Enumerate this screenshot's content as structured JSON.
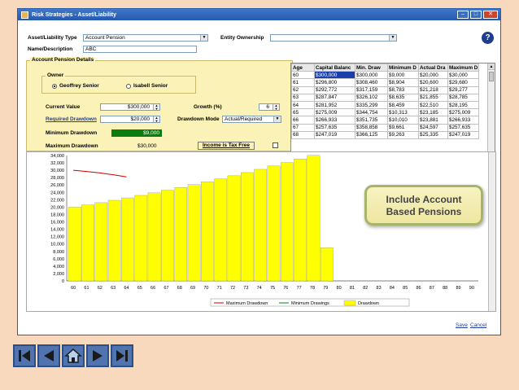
{
  "window": {
    "title": "Risk Strategies - Asset/Liability"
  },
  "form": {
    "asset_type_label": "Asset/Liability Type",
    "asset_type_value": "Account Pension",
    "entity_label": "Entity Ownership",
    "entity_value": "",
    "name_label": "Name/Description",
    "name_value": "ABC"
  },
  "details": {
    "group_title": "Account Pension Details",
    "owner_title": "Owner",
    "owner_options": [
      "Geoffrey Senior",
      "Isabell Senior"
    ],
    "current_value_label": "Current Value",
    "current_value": "$300,000",
    "growth_label": "Growth (%)",
    "growth_value": "6",
    "required_drawdown_label": "Required Drawdown",
    "required_drawdown_value": "$20,000",
    "drawdown_mode_label": "Drawdown Mode",
    "drawdown_mode_value": "Actual/Required",
    "minimum_drawdown_label": "Minimum Drawdown",
    "minimum_drawdown_value": "$9,000",
    "maximum_drawdown_label": "Maximum Drawdown",
    "maximum_drawdown_value": "$30,000",
    "income_button": "Income is Tax Free"
  },
  "grid": {
    "headers": [
      "Age",
      "Capital Balanc",
      "Min. Draw",
      "Minimum D",
      "Actual Dra",
      "Maximum D"
    ],
    "rows": [
      [
        "60",
        "$300,000",
        "$300,000",
        "$9,000",
        "$20,000",
        "$30,000"
      ],
      [
        "61",
        "$296,800",
        "$308,460",
        "$8,904",
        "$20,600",
        "$29,680"
      ],
      [
        "62",
        "$292,772",
        "$317,159",
        "$8,783",
        "$21,218",
        "$29,277"
      ],
      [
        "63",
        "$287,847",
        "$326,102",
        "$8,635",
        "$21,855",
        "$28,785"
      ],
      [
        "64",
        "$281,952",
        "$335,299",
        "$8,459",
        "$22,510",
        "$28,195"
      ],
      [
        "65",
        "$275,009",
        "$344,754",
        "$10,313",
        "$23,185",
        "$275,009"
      ],
      [
        "66",
        "$266,933",
        "$351,735",
        "$10,010",
        "$23,881",
        "$266,933"
      ],
      [
        "67",
        "$257,635",
        "$358,858",
        "$9,661",
        "$24,597",
        "$257,635"
      ],
      [
        "68",
        "$247,019",
        "$366,125",
        "$9,263",
        "$25,335",
        "$247,019"
      ]
    ]
  },
  "chart_data": {
    "type": "bar",
    "categories": [
      "60",
      "61",
      "62",
      "63",
      "64",
      "65",
      "66",
      "67",
      "68",
      "69",
      "70",
      "71",
      "72",
      "73",
      "74",
      "75",
      "76",
      "77",
      "78",
      "79",
      "80",
      "81",
      "82",
      "83",
      "84",
      "85",
      "86",
      "87",
      "88",
      "89",
      "90"
    ],
    "series": [
      {
        "name": "Drawdown",
        "values": [
          20000,
          20600,
          21218,
          21855,
          22510,
          23185,
          23881,
          24597,
          25335,
          26095,
          26878,
          27685,
          28515,
          29371,
          30252,
          31159,
          32094,
          33057,
          34049,
          9000,
          0,
          0,
          0,
          0,
          0,
          0,
          0,
          0,
          0,
          0,
          0
        ],
        "color": "#ffff00"
      },
      {
        "name": "Maximum Drawdown",
        "values": [
          30000,
          29680,
          29277,
          28785,
          28195
        ],
        "color": "#cc0000"
      },
      {
        "name": "Minimum Drawings",
        "values": [],
        "color": "#0a7d10"
      }
    ],
    "yticks": [
      "0",
      "2,000",
      "4,000",
      "6,000",
      "8,000",
      "10,000",
      "12,000",
      "14,000",
      "16,000",
      "18,000",
      "20,000",
      "22,000",
      "24,000",
      "26,000",
      "28,000",
      "30,000",
      "32,000",
      "34,000"
    ],
    "ylim": [
      0,
      34000
    ],
    "legend": [
      "Maximum Drawdown",
      "Minimum Drawings",
      "Drawdown"
    ],
    "legend_position": "bottom"
  },
  "callout": {
    "line1": "Include Account",
    "line2": "Based Pensions"
  },
  "footer": {
    "save": "Save",
    "cancel": "Cancel"
  },
  "nav": {
    "first": "first-icon",
    "prev": "previous-icon",
    "home": "home-icon",
    "next": "next-icon",
    "last": "last-icon"
  }
}
